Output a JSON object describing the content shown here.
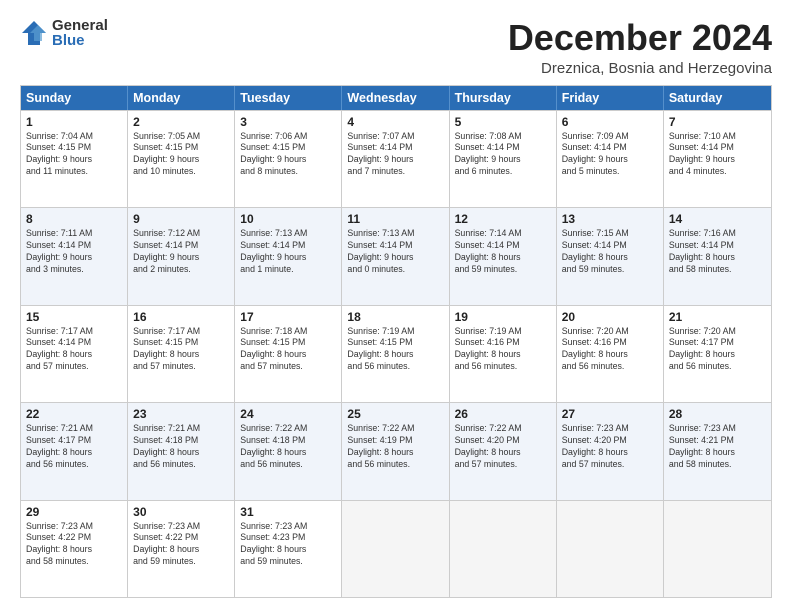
{
  "logo": {
    "general": "General",
    "blue": "Blue"
  },
  "title": "December 2024",
  "subtitle": "Dreznica, Bosnia and Herzegovina",
  "days": [
    "Sunday",
    "Monday",
    "Tuesday",
    "Wednesday",
    "Thursday",
    "Friday",
    "Saturday"
  ],
  "weeks": [
    [
      {
        "day": "1",
        "info": "Sunrise: 7:04 AM\nSunset: 4:15 PM\nDaylight: 9 hours\nand 11 minutes."
      },
      {
        "day": "2",
        "info": "Sunrise: 7:05 AM\nSunset: 4:15 PM\nDaylight: 9 hours\nand 10 minutes."
      },
      {
        "day": "3",
        "info": "Sunrise: 7:06 AM\nSunset: 4:15 PM\nDaylight: 9 hours\nand 8 minutes."
      },
      {
        "day": "4",
        "info": "Sunrise: 7:07 AM\nSunset: 4:14 PM\nDaylight: 9 hours\nand 7 minutes."
      },
      {
        "day": "5",
        "info": "Sunrise: 7:08 AM\nSunset: 4:14 PM\nDaylight: 9 hours\nand 6 minutes."
      },
      {
        "day": "6",
        "info": "Sunrise: 7:09 AM\nSunset: 4:14 PM\nDaylight: 9 hours\nand 5 minutes."
      },
      {
        "day": "7",
        "info": "Sunrise: 7:10 AM\nSunset: 4:14 PM\nDaylight: 9 hours\nand 4 minutes."
      }
    ],
    [
      {
        "day": "8",
        "info": "Sunrise: 7:11 AM\nSunset: 4:14 PM\nDaylight: 9 hours\nand 3 minutes."
      },
      {
        "day": "9",
        "info": "Sunrise: 7:12 AM\nSunset: 4:14 PM\nDaylight: 9 hours\nand 2 minutes."
      },
      {
        "day": "10",
        "info": "Sunrise: 7:13 AM\nSunset: 4:14 PM\nDaylight: 9 hours\nand 1 minute."
      },
      {
        "day": "11",
        "info": "Sunrise: 7:13 AM\nSunset: 4:14 PM\nDaylight: 9 hours\nand 0 minutes."
      },
      {
        "day": "12",
        "info": "Sunrise: 7:14 AM\nSunset: 4:14 PM\nDaylight: 8 hours\nand 59 minutes."
      },
      {
        "day": "13",
        "info": "Sunrise: 7:15 AM\nSunset: 4:14 PM\nDaylight: 8 hours\nand 59 minutes."
      },
      {
        "day": "14",
        "info": "Sunrise: 7:16 AM\nSunset: 4:14 PM\nDaylight: 8 hours\nand 58 minutes."
      }
    ],
    [
      {
        "day": "15",
        "info": "Sunrise: 7:17 AM\nSunset: 4:14 PM\nDaylight: 8 hours\nand 57 minutes."
      },
      {
        "day": "16",
        "info": "Sunrise: 7:17 AM\nSunset: 4:15 PM\nDaylight: 8 hours\nand 57 minutes."
      },
      {
        "day": "17",
        "info": "Sunrise: 7:18 AM\nSunset: 4:15 PM\nDaylight: 8 hours\nand 57 minutes."
      },
      {
        "day": "18",
        "info": "Sunrise: 7:19 AM\nSunset: 4:15 PM\nDaylight: 8 hours\nand 56 minutes."
      },
      {
        "day": "19",
        "info": "Sunrise: 7:19 AM\nSunset: 4:16 PM\nDaylight: 8 hours\nand 56 minutes."
      },
      {
        "day": "20",
        "info": "Sunrise: 7:20 AM\nSunset: 4:16 PM\nDaylight: 8 hours\nand 56 minutes."
      },
      {
        "day": "21",
        "info": "Sunrise: 7:20 AM\nSunset: 4:17 PM\nDaylight: 8 hours\nand 56 minutes."
      }
    ],
    [
      {
        "day": "22",
        "info": "Sunrise: 7:21 AM\nSunset: 4:17 PM\nDaylight: 8 hours\nand 56 minutes."
      },
      {
        "day": "23",
        "info": "Sunrise: 7:21 AM\nSunset: 4:18 PM\nDaylight: 8 hours\nand 56 minutes."
      },
      {
        "day": "24",
        "info": "Sunrise: 7:22 AM\nSunset: 4:18 PM\nDaylight: 8 hours\nand 56 minutes."
      },
      {
        "day": "25",
        "info": "Sunrise: 7:22 AM\nSunset: 4:19 PM\nDaylight: 8 hours\nand 56 minutes."
      },
      {
        "day": "26",
        "info": "Sunrise: 7:22 AM\nSunset: 4:20 PM\nDaylight: 8 hours\nand 57 minutes."
      },
      {
        "day": "27",
        "info": "Sunrise: 7:23 AM\nSunset: 4:20 PM\nDaylight: 8 hours\nand 57 minutes."
      },
      {
        "day": "28",
        "info": "Sunrise: 7:23 AM\nSunset: 4:21 PM\nDaylight: 8 hours\nand 58 minutes."
      }
    ],
    [
      {
        "day": "29",
        "info": "Sunrise: 7:23 AM\nSunset: 4:22 PM\nDaylight: 8 hours\nand 58 minutes."
      },
      {
        "day": "30",
        "info": "Sunrise: 7:23 AM\nSunset: 4:22 PM\nDaylight: 8 hours\nand 59 minutes."
      },
      {
        "day": "31",
        "info": "Sunrise: 7:23 AM\nSunset: 4:23 PM\nDaylight: 8 hours\nand 59 minutes."
      },
      {
        "day": "",
        "info": ""
      },
      {
        "day": "",
        "info": ""
      },
      {
        "day": "",
        "info": ""
      },
      {
        "day": "",
        "info": ""
      }
    ]
  ]
}
